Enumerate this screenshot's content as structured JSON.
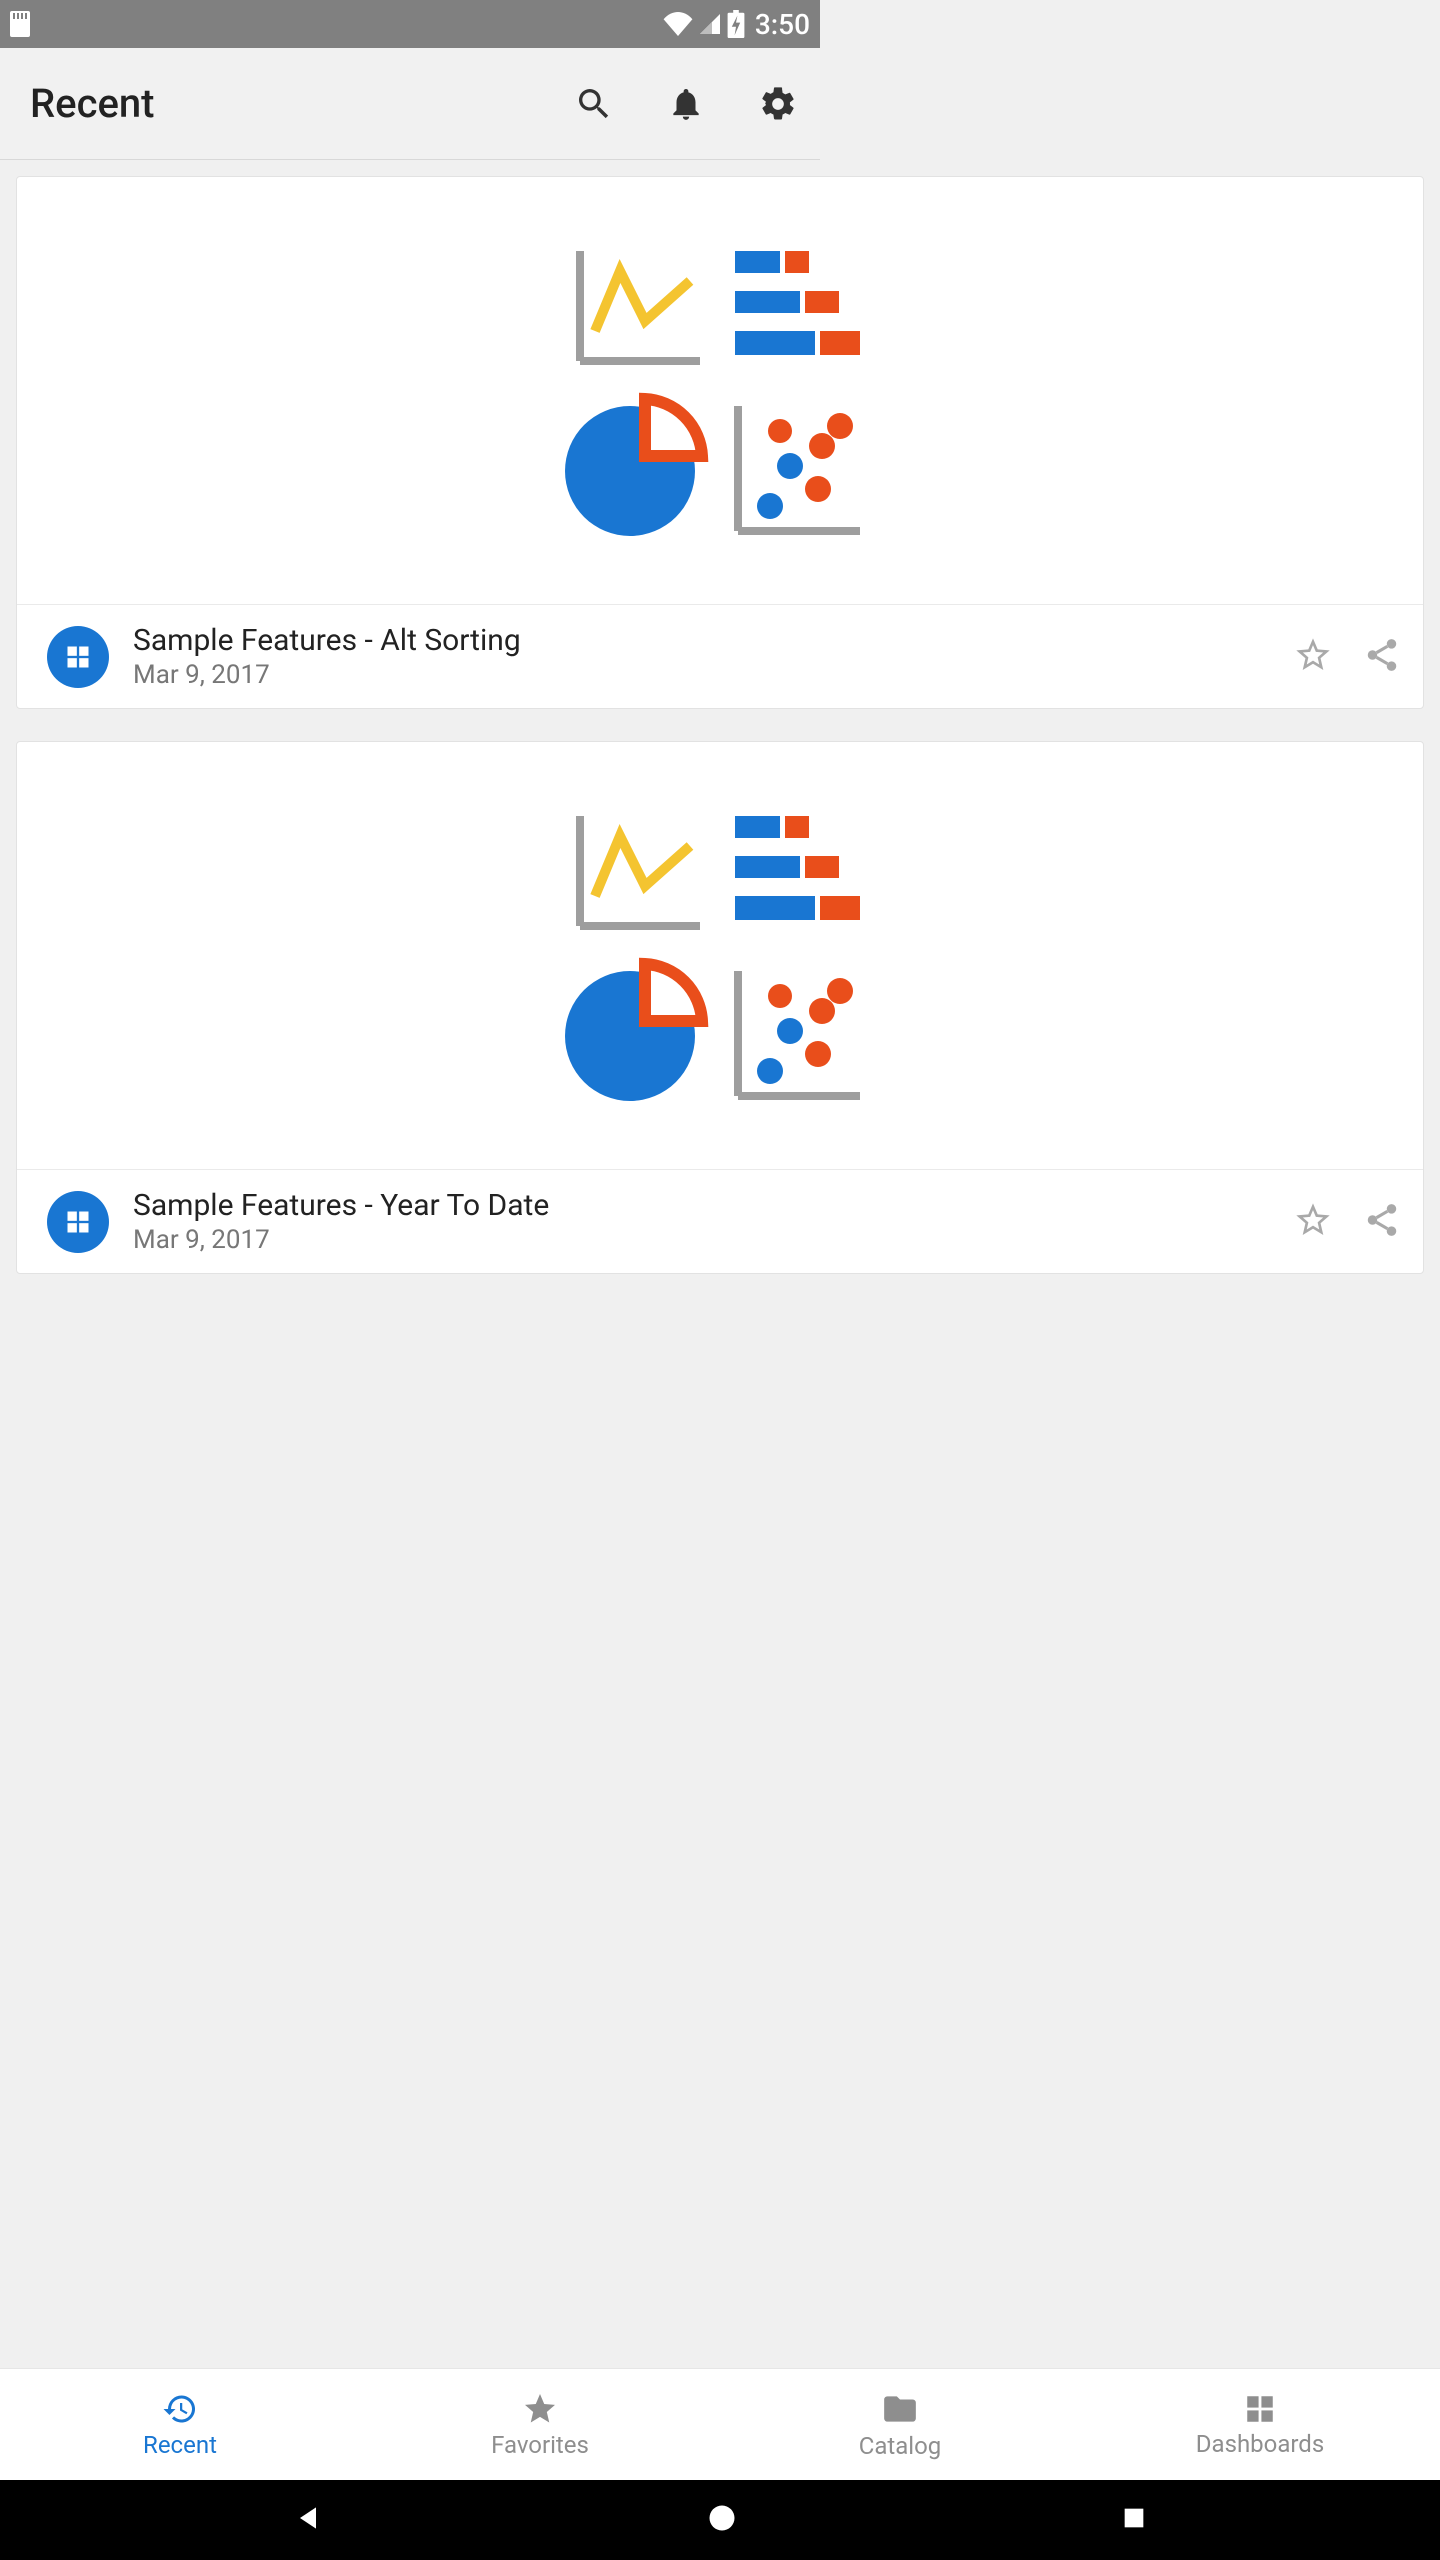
{
  "status": {
    "time": "3:50"
  },
  "appbar": {
    "title": "Recent"
  },
  "cards": [
    {
      "title": "Sample Features - Alt Sorting",
      "date": "Mar 9, 2017"
    },
    {
      "title": "Sample Features - Year To Date",
      "date": "Mar 9, 2017"
    }
  ],
  "bottom_nav": {
    "items": [
      {
        "label": "Recent"
      },
      {
        "label": "Favorites"
      },
      {
        "label": "Catalog"
      },
      {
        "label": "Dashboards"
      }
    ]
  }
}
